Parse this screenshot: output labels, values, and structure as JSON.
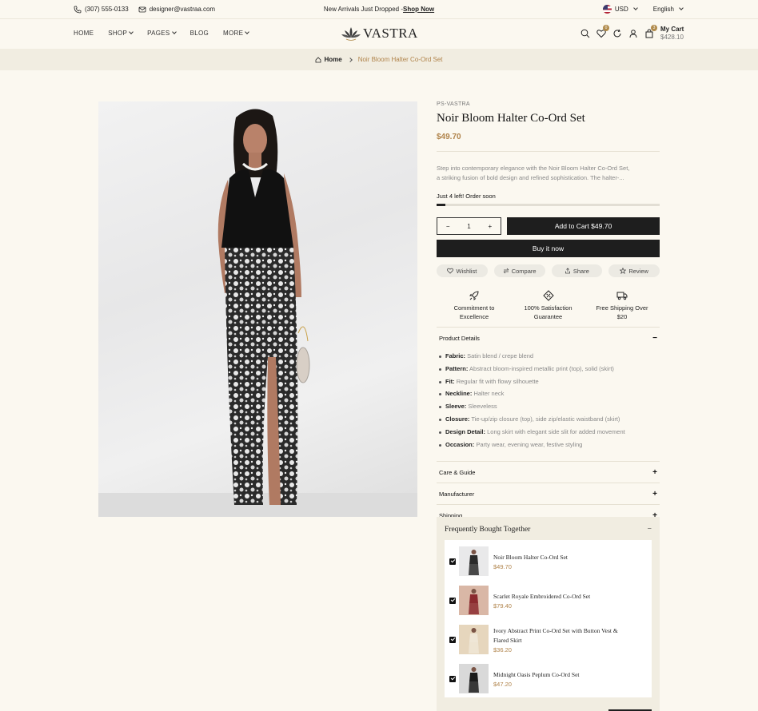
{
  "topbar": {
    "phone": "(307) 555-0133",
    "email": "designer@vastraa.com",
    "announcement": "New Arrivals Just Dropped -",
    "announcement_link": "Shop Now",
    "currency": "USD",
    "language": "English"
  },
  "header": {
    "nav": [
      "HOME",
      "SHOP",
      "PAGES",
      "BLOG",
      "MORE"
    ],
    "logo": "VASTRA",
    "wishlist_count": "0",
    "cart_count": "3",
    "cart_label": "My Cart",
    "cart_total": "$428.10"
  },
  "breadcrumb": {
    "home": "Home",
    "current": "Noir Bloom Halter Co-Ord Set"
  },
  "product": {
    "vendor": "PS-VASTRA",
    "title": "Noir Bloom Halter Co-Ord Set",
    "price": "$49.70",
    "description_line1": "Step into contemporary elegance with the Noir Bloom Halter Co-Ord Set,",
    "description_line2": "a striking fusion of bold design and refined sophistication. The halter-...",
    "stock_text": "Just 4 left! Order soon",
    "stock_level": 0.04,
    "quantity": "1",
    "qty_minus": "−",
    "qty_plus": "+",
    "add_to_cart": "Add to Cart $49.70",
    "buy_now": "Buy it now",
    "pills": [
      "Wishlist",
      "Compare",
      "Share",
      "Review"
    ],
    "features": [
      {
        "line1": "Commitment to",
        "line2": "Excellence",
        "icon": "rocket-icon"
      },
      {
        "line1": "100% Satisfaction",
        "line2": "Guarantee",
        "icon": "badge-percent-icon"
      },
      {
        "line1": "Free Shipping Over",
        "line2": "$20",
        "icon": "truck-icon"
      }
    ]
  },
  "accordions": {
    "details_title": "Product Details",
    "details_sign": "−",
    "details": [
      {
        "label": "Fabric:",
        "value": "Satin blend / crepe blend"
      },
      {
        "label": "Pattern:",
        "value": "Abstract bloom-inspired metallic print (top), solid (skirt)"
      },
      {
        "label": "Fit:",
        "value": "Regular fit with flowy silhouette"
      },
      {
        "label": "Neckline:",
        "value": "Halter neck"
      },
      {
        "label": "Sleeve:",
        "value": "Sleeveless"
      },
      {
        "label": "Closure:",
        "value": "Tie-up/zip closure (top), side zip/elastic waistband (skirt)"
      },
      {
        "label": "Design Detail:",
        "value": "Long skirt with elegant side slit for added movement"
      },
      {
        "label": "Occasion:",
        "value": "Party wear, evening wear, festive styling"
      }
    ],
    "care": "Care & Guide",
    "manufacturer": "Manufacturer",
    "shipping": "Shipping",
    "plus": "+"
  },
  "fbt": {
    "title": "Frequently Bought Together",
    "sign": "−",
    "items": [
      {
        "name": "Noir Bloom Halter Co-Ord Set",
        "name2": "",
        "price": "$49.70",
        "swatch": "#2b2b2b",
        "bg": "#e9e9ea"
      },
      {
        "name": "Scarlet Royale Embroidered Co-Ord Set",
        "name2": "",
        "price": "$79.40",
        "swatch": "#8b2b2f",
        "bg": "#d9b7a6"
      },
      {
        "name": "Ivory Abstract Print Co-Ord Set with Button Vest &",
        "name2": "Flared Skirt",
        "price": "$36.20",
        "swatch": "#efe6d6",
        "bg": "#e6d6bd"
      },
      {
        "name": "Midnight Oasis Peplum Co-Ord Set",
        "name2": "",
        "price": "$47.20",
        "swatch": "#1b1b1b",
        "bg": "#d9d9d9"
      }
    ]
  }
}
